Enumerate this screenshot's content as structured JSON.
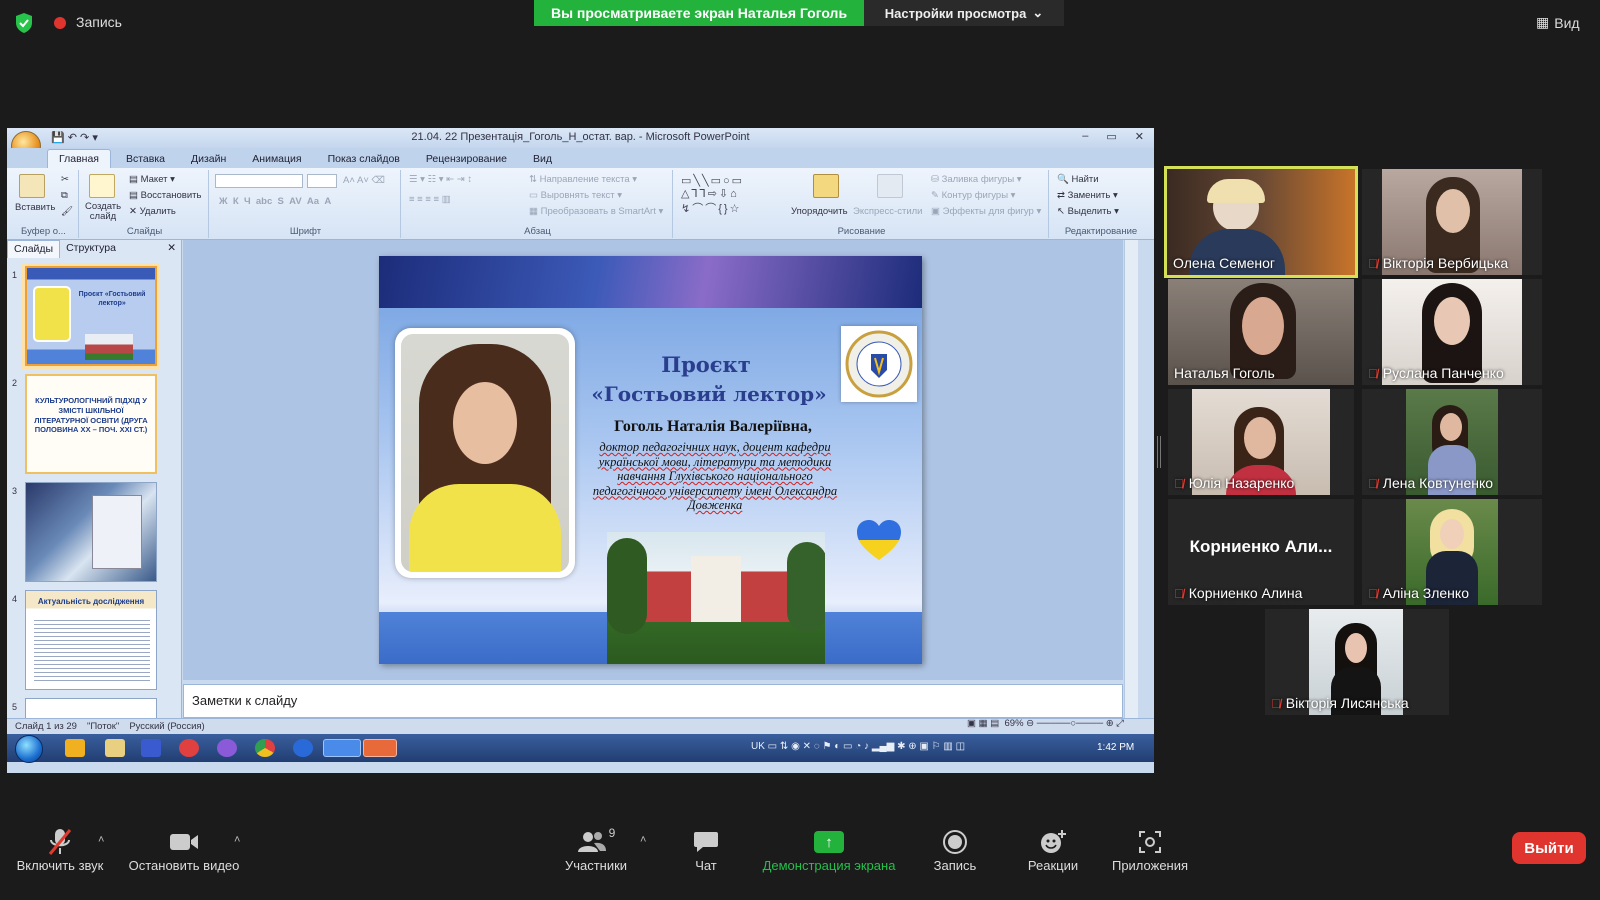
{
  "topbar": {
    "recording_label": "Запись",
    "viewing_banner": "Вы просматриваете экран Наталья Гоголь",
    "view_settings": "Настройки просмотра",
    "view_button": "Вид",
    "colors": {
      "banner": "#23b33d",
      "record": "#e0352e"
    }
  },
  "powerpoint": {
    "window_title": "21.04. 22 Презентація_Гоголь_Н_остат. вар. - Microsoft PowerPoint",
    "tabs": [
      "Главная",
      "Вставка",
      "Дизайн",
      "Анимация",
      "Показ слайдов",
      "Рецензирование",
      "Вид"
    ],
    "ribbon": {
      "clipboard": {
        "paste": "Вставить",
        "group": "Буфер о..."
      },
      "slides": {
        "new_slide": "Создать слайд",
        "layout": "Макет",
        "reset": "Восстановить",
        "delete": "Удалить",
        "group": "Слайды"
      },
      "font": {
        "group": "Шрифт"
      },
      "paragraph": {
        "text_direction": "Направление текста",
        "align_text": "Выровнять текст",
        "smartart": "Преобразовать в SmartArt",
        "group": "Абзац"
      },
      "drawing": {
        "arrange": "Упорядочить",
        "quick_styles": "Экспресс-стили",
        "fill": "Заливка фигуры",
        "outline": "Контур фигуры",
        "effects": "Эффекты для фигур",
        "group": "Рисование"
      },
      "editing": {
        "find": "Найти",
        "replace": "Заменить",
        "select": "Выделить",
        "group": "Редактирование"
      }
    },
    "pane_tabs": [
      "Слайды",
      "Структура"
    ],
    "thumbnails": [
      {
        "num": "1",
        "text": "Проєкт «Гостьовий лектор»"
      },
      {
        "num": "2",
        "text": "КУЛЬТУРОЛОГІЧНИЙ ПІДХІД У ЗМІСТІ ШКІЛЬНОЇ ЛІТЕРАТУРНОЇ ОСВІТИ (ДРУГА ПОЛОВИНА ХХ – ПОЧ. ХХІ СТ.)"
      },
      {
        "num": "3",
        "text": ""
      },
      {
        "num": "4",
        "text": "Актуальність дослідження"
      },
      {
        "num": "5",
        "text": ""
      }
    ],
    "slide": {
      "title_line1": "Проєкт",
      "title_line2": "«Гостьовий лектор»",
      "author": "Гоголь Наталія Валеріївна,",
      "description": "доктор педагогічних наук, доцент кафедри української мови, літератури та методики навчання Глухівського національного педагогічного університету імені Олександра Довженка"
    },
    "notes_placeholder": "Заметки к слайду",
    "status": {
      "slide_counter": "Слайд 1 из 29",
      "theme": "\"Поток\"",
      "language": "Русский (Россия)",
      "zoom": "69%"
    },
    "taskbar": {
      "lang": "UK",
      "clock": "1:42 PM"
    }
  },
  "participants": [
    {
      "name": "Олена Семеног",
      "muted": false,
      "active_speaker": true,
      "video": true
    },
    {
      "name": "Вікторія Вербицька",
      "muted": true,
      "active_speaker": false,
      "video": true
    },
    {
      "name": "Наталья Гоголь",
      "muted": false,
      "active_speaker": false,
      "video": true
    },
    {
      "name": "Руслана Панченко",
      "muted": true,
      "active_speaker": false,
      "video": true
    },
    {
      "name": "Юлія Назаренко",
      "muted": true,
      "active_speaker": false,
      "video": true
    },
    {
      "name": "Лена   Ковтуненко",
      "muted": true,
      "active_speaker": false,
      "video": true
    },
    {
      "name": "Корниенко Алина",
      "big_name": "Корниенко  Али...",
      "muted": true,
      "active_speaker": false,
      "video": false
    },
    {
      "name": "Аліна Зленко",
      "muted": true,
      "active_speaker": false,
      "video": true
    },
    {
      "name": "Вікторія Лисянська",
      "muted": true,
      "active_speaker": false,
      "video": true
    }
  ],
  "toolbar": {
    "unmute": "Включить звук",
    "stop_video": "Остановить видео",
    "participants": "Участники",
    "participants_count": "9",
    "chat": "Чат",
    "share_screen": "Демонстрация экрана",
    "record": "Запись",
    "reactions": "Реакции",
    "apps": "Приложения",
    "leave": "Выйти"
  }
}
